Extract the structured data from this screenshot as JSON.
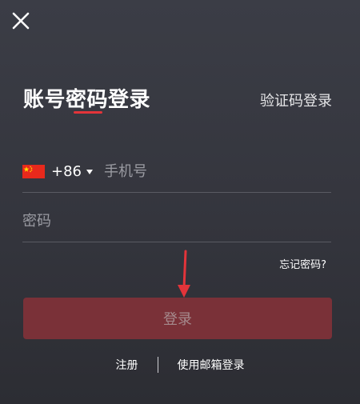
{
  "header": {
    "close_icon": "close-icon",
    "title": "账号密码登录",
    "switch_label": "验证码登录",
    "accent_color": "#e3343a"
  },
  "form": {
    "country_flag": "china-flag-icon",
    "country_code": "+86",
    "phone_placeholder": "手机号",
    "phone_value": "",
    "password_placeholder": "密码",
    "password_value": "",
    "forgot_label": "忘记密码?"
  },
  "actions": {
    "login_label": "登录",
    "login_color": "#7a3138",
    "register_label": "注册",
    "email_login_label": "使用邮箱登录"
  }
}
